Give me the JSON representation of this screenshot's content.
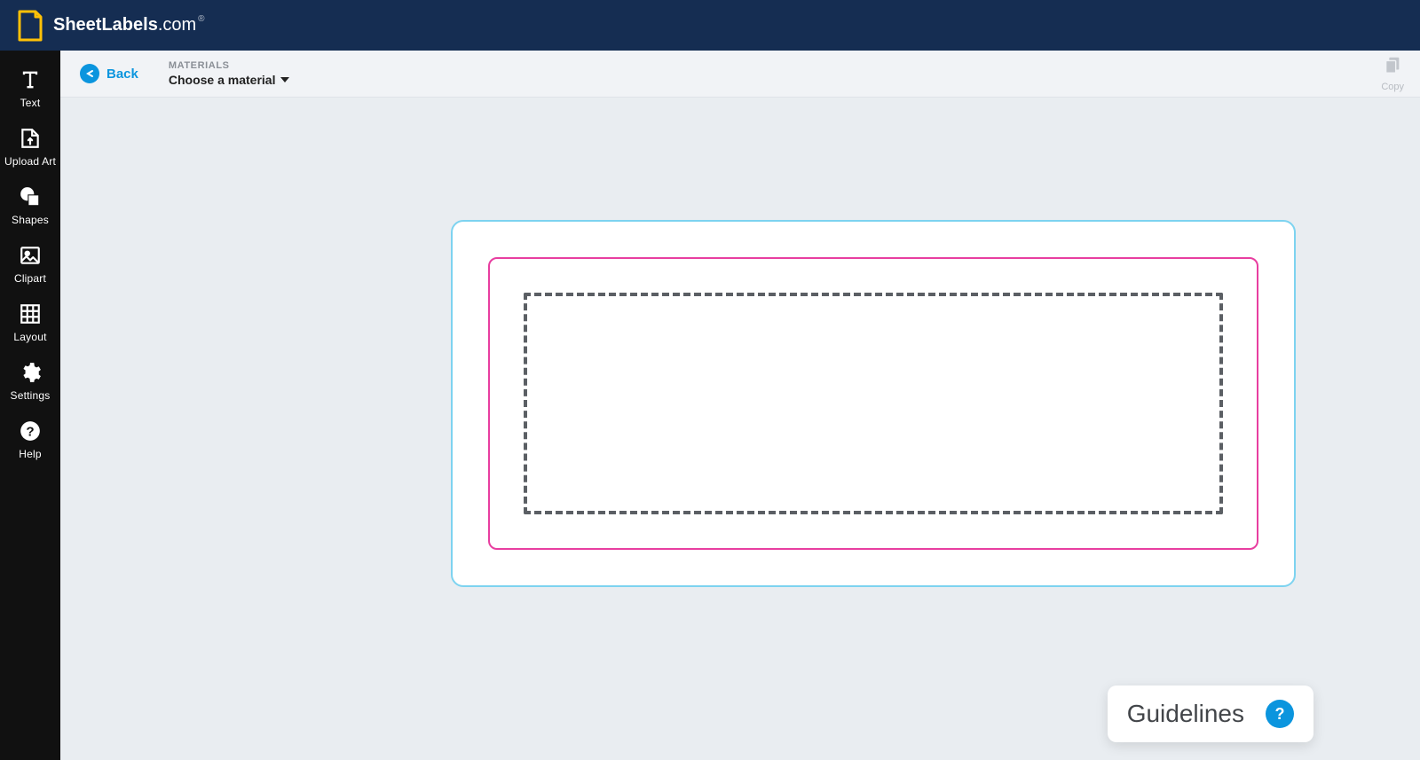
{
  "brand": {
    "bold": "SheetLabels",
    "light": ".com",
    "reg": "®"
  },
  "sidebar": {
    "items": [
      {
        "label": "Text"
      },
      {
        "label": "Upload Art"
      },
      {
        "label": "Shapes"
      },
      {
        "label": "Clipart"
      },
      {
        "label": "Layout"
      },
      {
        "label": "Settings"
      },
      {
        "label": "Help"
      }
    ]
  },
  "toolbar": {
    "back_label": "Back",
    "materials_label": "MATERIALS",
    "material_selected": "Choose a material",
    "copy_label": "Copy"
  },
  "guidelines": {
    "title": "Guidelines",
    "help": "?"
  }
}
